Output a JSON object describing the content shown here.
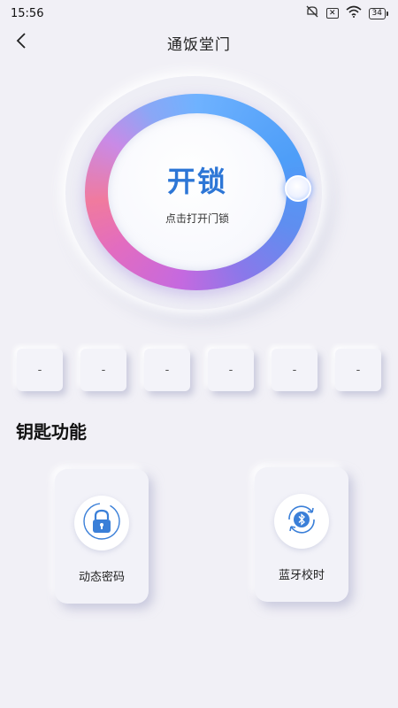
{
  "status_bar": {
    "time": "15:56",
    "sim_status": "✕",
    "battery": "34",
    "icons": [
      "mute-icon",
      "sim-x-icon",
      "wifi-icon",
      "battery-icon"
    ]
  },
  "nav": {
    "title": "通饭堂门",
    "back_icon": "chevron-left-icon"
  },
  "unlock": {
    "label": "开锁",
    "hint": "点击打开门锁",
    "accent_color": "#2d76d6"
  },
  "code_boxes": [
    "-",
    "-",
    "-",
    "-",
    "-",
    "-"
  ],
  "functions": {
    "title": "钥匙功能",
    "items": [
      {
        "label": "动态密码",
        "icon": "lock-icon"
      },
      {
        "label": "蓝牙校时",
        "icon": "bluetooth-sync-icon"
      }
    ]
  }
}
